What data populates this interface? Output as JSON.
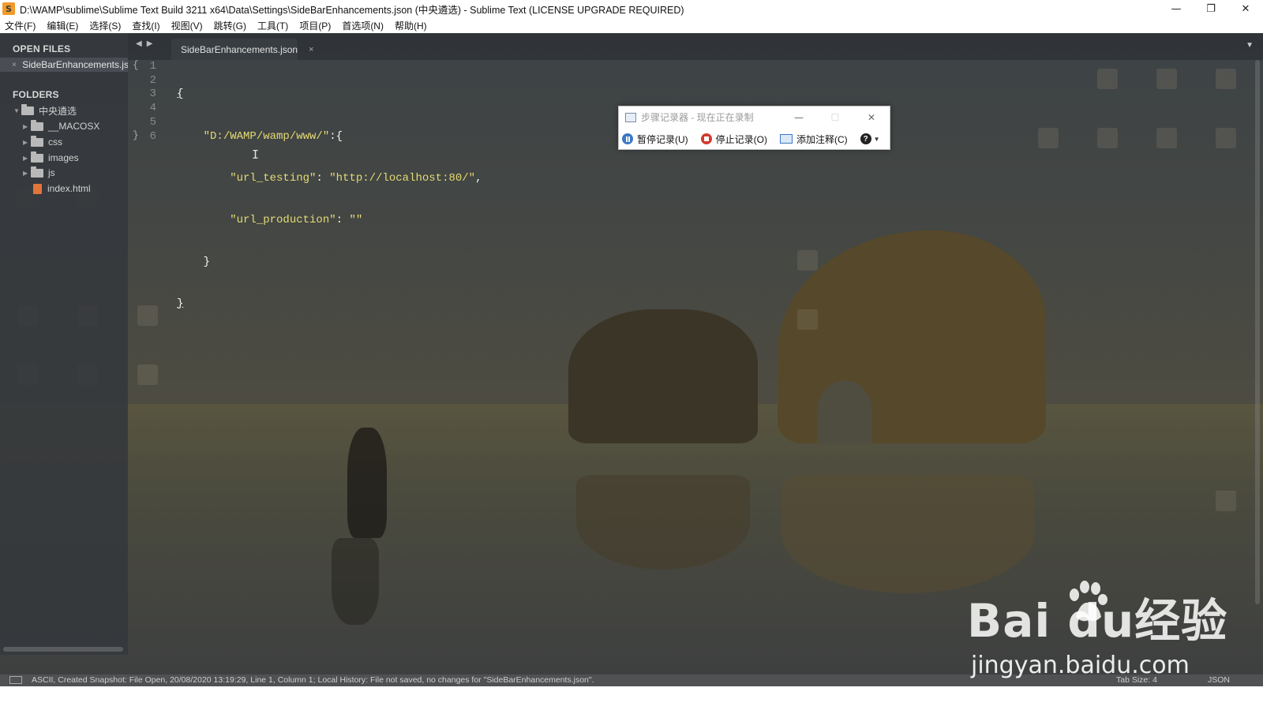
{
  "window": {
    "title": "D:\\WAMP\\sublime\\Sublime Text Build 3211 x64\\Data\\Settings\\SideBarEnhancements.json (中央遴选) - Sublime Text (LICENSE UPGRADE REQUIRED)",
    "app_icon": "S",
    "controls": {
      "minimize": "—",
      "restore": "❐",
      "close": "✕"
    }
  },
  "menu": [
    "文件(F)",
    "编辑(E)",
    "选择(S)",
    "查找(I)",
    "视图(V)",
    "跳转(G)",
    "工具(T)",
    "项目(P)",
    "首选项(N)",
    "帮助(H)"
  ],
  "sidebar": {
    "open_files_heading": "OPEN FILES",
    "open_files": [
      {
        "name": "SideBarEnhancements.jso",
        "close": "×"
      }
    ],
    "folders_heading": "FOLDERS",
    "root_folder": "中央遴选",
    "items": [
      {
        "type": "folder",
        "name": "__MACOSX"
      },
      {
        "type": "folder",
        "name": "css"
      },
      {
        "type": "folder",
        "name": "images"
      },
      {
        "type": "folder",
        "name": "js"
      },
      {
        "type": "file",
        "name": "index.html"
      }
    ]
  },
  "tabs": [
    {
      "label": "SideBarEnhancements.json",
      "close": "×"
    }
  ],
  "editor": {
    "line_numbers": [
      "1",
      "2",
      "3",
      "4",
      "5",
      "6"
    ],
    "lines": [
      {
        "brace_open": "{"
      },
      {
        "indent": "    ",
        "key": "\"D:/WAMP/wamp/www/\"",
        "sep": ":{"
      },
      {
        "indent": "        ",
        "key": "\"url_testing\"",
        "sep": ": ",
        "value": "\"http://localhost:80/\"",
        "tail": ","
      },
      {
        "indent": "        ",
        "key": "\"url_production\"",
        "sep": ": ",
        "value": "\"\""
      },
      {
        "indent": "    ",
        "brace_close": "}"
      },
      {
        "brace_close": "}"
      }
    ]
  },
  "steps_recorder": {
    "title": "步骤记录器 - 现在正在录制",
    "buttons": [
      {
        "label": "暂停记录(U)",
        "icon": "pause-icon"
      },
      {
        "label": "停止记录(O)",
        "icon": "stop-icon"
      },
      {
        "label": "添加注释(C)",
        "icon": "comment-icon"
      }
    ],
    "help": "?",
    "controls": {
      "minimize": "—",
      "maximize": "☐",
      "close": "✕"
    }
  },
  "statusbar": {
    "text": "ASCII, Created Snapshot: File Open, 20/08/2020 13:19:29, Line 1, Column 1; Local History: File not saved, no changes for \"SideBarEnhancements.json\".",
    "tab_size": "Tab Size: 4",
    "syntax": "JSON"
  },
  "watermark": {
    "logo": "Bai  du经验",
    "url": "jingyan.baidu.com"
  }
}
